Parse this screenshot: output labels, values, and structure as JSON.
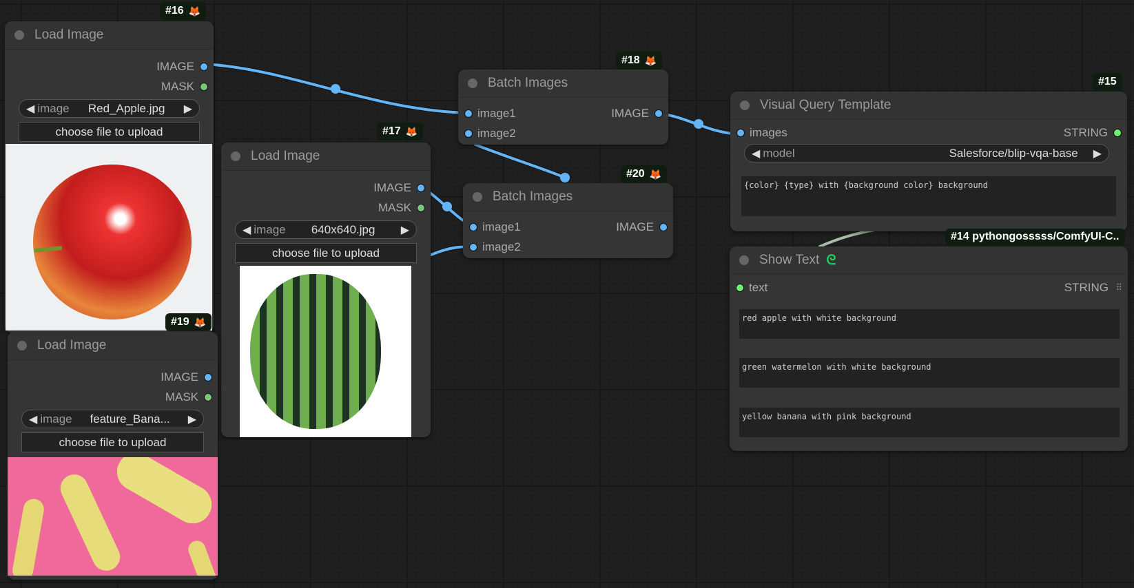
{
  "canvas": {
    "grid_bg": "#1f1f1f",
    "wire_color": "#64b5f6",
    "string_wire_color": "#a9bfa9"
  },
  "nodes": {
    "n16": {
      "badge": "#16",
      "title": "Load Image",
      "outputs": [
        "IMAGE",
        "MASK"
      ],
      "combo_label": "image",
      "combo_value": "Red_Apple.jpg",
      "upload_label": "choose file to upload",
      "preview_subject": "red apple on white background"
    },
    "n17": {
      "badge": "#17",
      "title": "Load Image",
      "outputs": [
        "IMAGE",
        "MASK"
      ],
      "combo_label": "image",
      "combo_value": "640x640.jpg",
      "upload_label": "choose file to upload",
      "preview_subject": "watermelon on white background"
    },
    "n19": {
      "badge": "#19",
      "title": "Load Image",
      "outputs": [
        "IMAGE",
        "MASK"
      ],
      "combo_label": "image",
      "combo_value": "feature_Bana...",
      "upload_label": "choose file to upload",
      "preview_subject": "bananas on pink background"
    },
    "n18": {
      "badge": "#18",
      "title": "Batch Images",
      "inputs": [
        "image1",
        "image2"
      ],
      "output": "IMAGE"
    },
    "n20": {
      "badge": "#20",
      "title": "Batch Images",
      "inputs": [
        "image1",
        "image2"
      ],
      "output": "IMAGE"
    },
    "n15": {
      "badge": "#15",
      "title": "Visual Query Template",
      "input": "images",
      "output": "STRING",
      "combo_label": "model",
      "combo_value": "Salesforce/blip-vqa-base",
      "template_text": "{color} {type} with {background color} background"
    },
    "n14": {
      "badge": "#14 pythongosssss/ComfyUI-C..",
      "title": "Show Text",
      "input": "text",
      "output": "STRING",
      "outputs_text": [
        "red apple with white background",
        "green watermelon with white background",
        "yellow banana with pink background"
      ]
    }
  }
}
